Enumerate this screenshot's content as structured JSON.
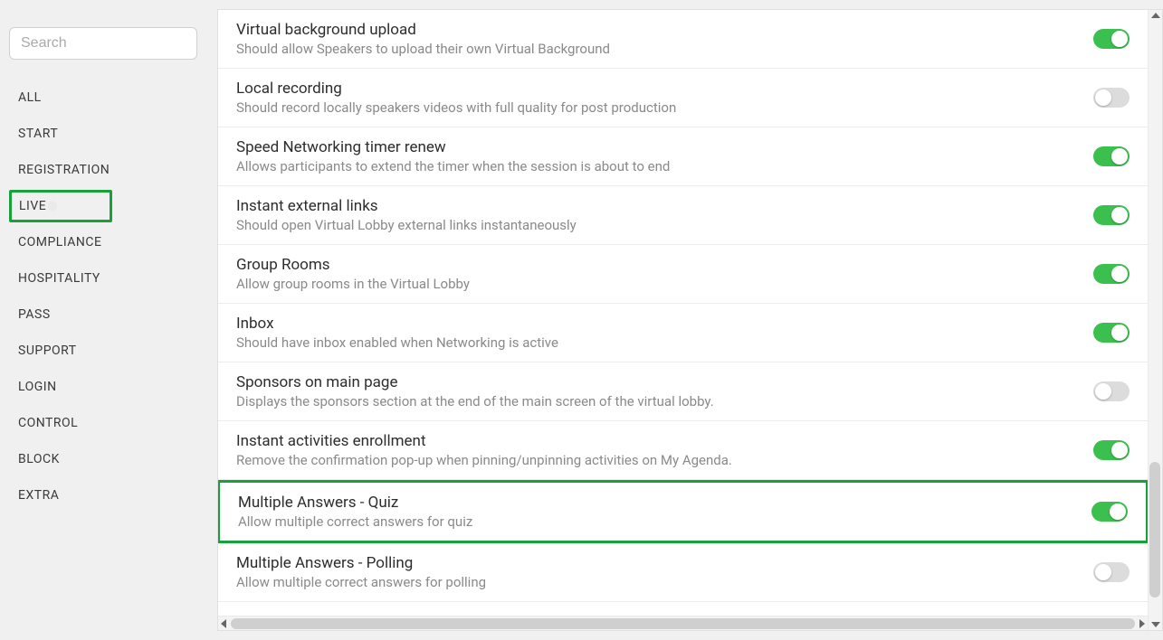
{
  "search": {
    "placeholder": "Search"
  },
  "sidebar": {
    "items": [
      {
        "label": "ALL",
        "active": false
      },
      {
        "label": "START",
        "active": false
      },
      {
        "label": "REGISTRATION",
        "active": false
      },
      {
        "label": "LIVE",
        "active": true
      },
      {
        "label": "COMPLIANCE",
        "active": false
      },
      {
        "label": "HOSPITALITY",
        "active": false
      },
      {
        "label": "PASS",
        "active": false
      },
      {
        "label": "SUPPORT",
        "active": false
      },
      {
        "label": "LOGIN",
        "active": false
      },
      {
        "label": "CONTROL",
        "active": false
      },
      {
        "label": "BLOCK",
        "active": false
      },
      {
        "label": "EXTRA",
        "active": false
      }
    ]
  },
  "settings": [
    {
      "title": "Virtual background upload",
      "desc": "Should allow Speakers to upload their own Virtual Background",
      "on": true,
      "highlight": false
    },
    {
      "title": "Local recording",
      "desc": "Should record locally speakers videos with full quality for post production",
      "on": false,
      "highlight": false
    },
    {
      "title": "Speed Networking timer renew",
      "desc": "Allows participants to extend the timer when the session is about to end",
      "on": true,
      "highlight": false
    },
    {
      "title": "Instant external links",
      "desc": "Should open Virtual Lobby external links instantaneously",
      "on": true,
      "highlight": false
    },
    {
      "title": "Group Rooms",
      "desc": "Allow group rooms in the Virtual Lobby",
      "on": true,
      "highlight": false
    },
    {
      "title": "Inbox",
      "desc": "Should have inbox enabled when Networking is active",
      "on": true,
      "highlight": false
    },
    {
      "title": "Sponsors on main page",
      "desc": "Displays the sponsors section at the end of the main screen of the virtual lobby.",
      "on": false,
      "highlight": false
    },
    {
      "title": "Instant activities enrollment",
      "desc": "Remove the confirmation pop-up when pinning/unpinning activities on My Agenda.",
      "on": true,
      "highlight": false
    },
    {
      "title": "Multiple Answers - Quiz",
      "desc": "Allow multiple correct answers for quiz",
      "on": true,
      "highlight": true
    },
    {
      "title": "Multiple Answers - Polling",
      "desc": "Allow multiple correct answers for polling",
      "on": false,
      "highlight": false
    }
  ]
}
